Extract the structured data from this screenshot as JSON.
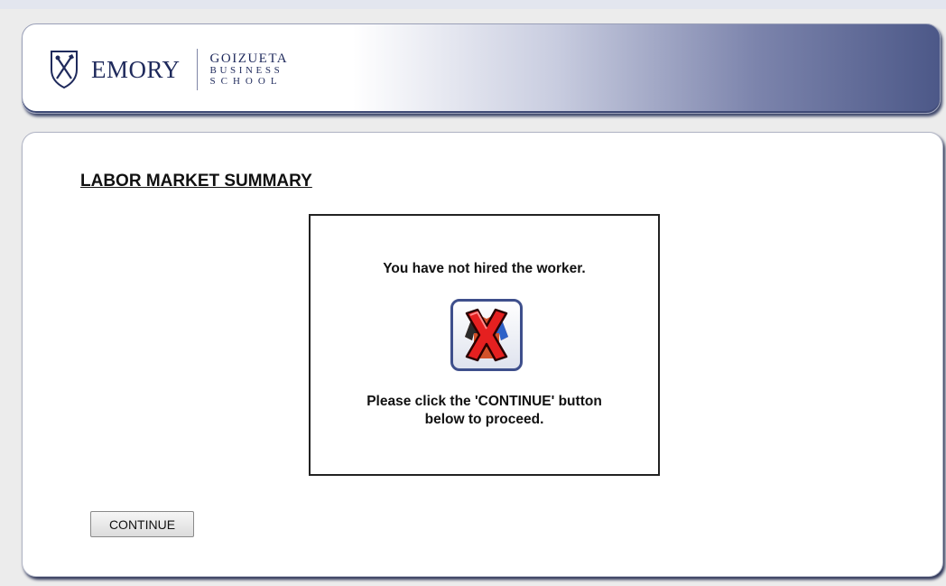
{
  "header": {
    "logo_emory": "EMORY",
    "logo_line1": "GOIZUETA",
    "logo_line2": "BUSINESS",
    "logo_line3": "SCHOOL",
    "shield_icon": "emory-shield-icon"
  },
  "main": {
    "title": "LABOR MARKET SUMMARY",
    "message": {
      "line1": "You have not hired the worker.",
      "icon": "worker-not-hired-x-icon",
      "line2a": "Please click the 'CONTINUE' button",
      "line2b": "below to proceed."
    },
    "continue_label": "CONTINUE"
  },
  "colors": {
    "navy": "#1f2a5c",
    "header_gradient_end": "#4c5888",
    "x_red": "#e52020"
  }
}
